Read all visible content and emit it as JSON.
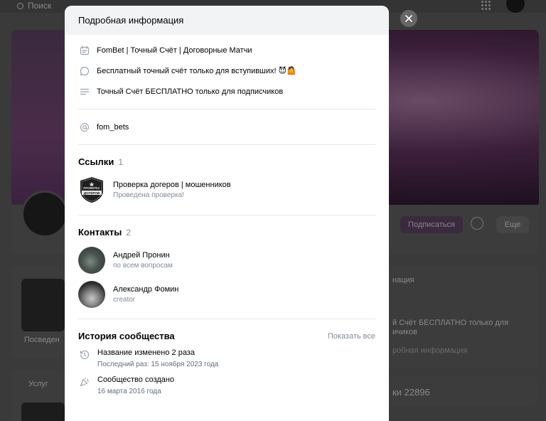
{
  "background": {
    "search_placeholder": "Поиск",
    "subscribe_label": "Подписаться",
    "more_label": "Еще",
    "left_card_text": "Посведен",
    "left_card2_text": "Услуг",
    "right_text_1": "нация",
    "right_text_2": "й Счёт БЕСПЛАТНО только для ичиков",
    "right_text_3": "робная информация",
    "right_text_4": "ки 22896"
  },
  "modal": {
    "title": "Подробная информация",
    "info_rows": [
      {
        "icon": "calendar-icon",
        "text": "FomBet | Точный Счёт | Договорные Матчи"
      },
      {
        "icon": "chat-bubble-icon",
        "text": "Бесплатный точный счёт только для вступивших! 😈🤷"
      },
      {
        "icon": "text-lines-icon",
        "text": "Точный Счёт БЕСПЛАТНО только для подписчиков"
      }
    ],
    "short_address": {
      "icon": "at-icon",
      "text": "fom_bets"
    },
    "links": {
      "title": "Ссылки",
      "count": "1",
      "items": [
        {
          "title": "Проверка догеров | мошенников",
          "subtitle": "Проведена проверка!",
          "badge_text_1": "ПРОВЕРКА",
          "badge_text_2": "ДОГЕРОВ"
        }
      ]
    },
    "contacts": {
      "title": "Контакты",
      "count": "2",
      "items": [
        {
          "name": "Андрей Пронин",
          "role": "по всем вопросам"
        },
        {
          "name": "Александр Фомин",
          "role": "creator"
        }
      ]
    },
    "history": {
      "title": "История сообщества",
      "show_all": "Показать все",
      "items": [
        {
          "icon": "history-icon",
          "title": "Название изменено 2 раза",
          "sub": "Последний раз: 15 ноября 2023 года"
        },
        {
          "icon": "party-popper-icon",
          "title": "Сообщество создано",
          "sub": "16 марта 2016 года"
        }
      ]
    }
  },
  "colors": {
    "overlay": "#3a3a3a",
    "modal_header": "#f2f3f5",
    "secondary_text": "#818c99",
    "separator": "#e7e8ec"
  }
}
